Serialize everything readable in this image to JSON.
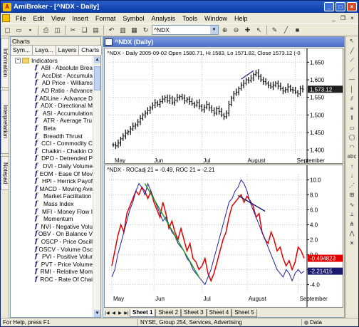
{
  "window": {
    "title": "AmiBroker - [^NDX - Daily]",
    "icon": "amibroker-icon"
  },
  "menu": [
    "File",
    "Edit",
    "View",
    "Insert",
    "Format",
    "Symbol",
    "Analysis",
    "Tools",
    "Window",
    "Help"
  ],
  "toolbar": {
    "symbol_value": "^NDX"
  },
  "side_tabs": [
    "Information",
    "Interpretation",
    "Notepad"
  ],
  "charts_panel": {
    "header": "Charts",
    "tabs": [
      "Sym...",
      "Layo...",
      "Layers",
      "Charts"
    ],
    "active_tab": "Charts",
    "folder": "Indicators",
    "items": [
      "ABI - Absolute Brea",
      "AccDist - Accumula",
      "AD Price - Williams",
      "AD Ratio - Advance",
      "ADLine - Advance D",
      "ADX - Directional M",
      "ASI - Accumulation",
      "ATR - Average Tru",
      "Beta",
      "Breadth Thrust",
      "CCI - Commodity C",
      "Chaikin - Chaikin O",
      "DPO - Detrended P",
      "DVI - Daily Volume",
      "EOM - Ease Of Mov",
      "HPI - Herrick Payof",
      "MACD - Moving Ave",
      "Market Facilitation",
      "Mass Index",
      "MFI - Money Flow I",
      "Momentum",
      "NVI - Negative Volu",
      "OBV - On Balance V",
      "OSCP - Price Oscill",
      "OSCV - Volume Osc",
      "PVI - Positive Volur",
      "PVT - Price Volume",
      "RMI - Relative Mom",
      "ROC - Rate Of Chai"
    ]
  },
  "chart_window": {
    "title": "^NDX (Daily)",
    "price_header": "^NDX - Daily 2005-09-02 Open 1580.71, Hi 1583, Lo 1571.82, Close 1573.12 (-0",
    "roc_header": "^NDX - ROCadj 21 = -0.49, ROC 21 = -2.21",
    "sheets": [
      "Sheet 1",
      "Sheet 2",
      "Sheet 3",
      "Sheet 4",
      "Sheet 5"
    ],
    "active_sheet": "Sheet 1"
  },
  "status": {
    "help": "For Help, press F1",
    "info": "NYSE, Group 254, Services, Advertising",
    "data": "Data"
  },
  "chart_data": [
    {
      "type": "bar",
      "title": "^NDX - Daily 2005-09-02 Open 1580.71, Hi 1583, Lo 1571.82, Close 1573.12 (-0",
      "categories": [
        "May",
        "Jun",
        "Jul",
        "August",
        "September"
      ],
      "yticks": [
        1400,
        1450,
        1500,
        1550,
        1600,
        1650
      ],
      "ylim": [
        1385,
        1665
      ],
      "last_value": "1,573.12",
      "closes": [
        1415,
        1412,
        1420,
        1432,
        1440,
        1448,
        1452,
        1460,
        1468,
        1472,
        1480,
        1490,
        1500,
        1505,
        1512,
        1520,
        1528,
        1535,
        1530,
        1538,
        1545,
        1550,
        1540,
        1548,
        1535,
        1542,
        1550,
        1552,
        1548,
        1540,
        1545,
        1538,
        1532,
        1528,
        1535,
        1525,
        1515,
        1522,
        1530,
        1520,
        1512,
        1505,
        1518,
        1510,
        1500,
        1495,
        1505,
        1530,
        1548,
        1560,
        1565,
        1575,
        1585,
        1590,
        1600,
        1598,
        1605,
        1615,
        1620,
        1610,
        1600,
        1595,
        1590,
        1585,
        1580,
        1585,
        1590,
        1582,
        1575,
        1568,
        1572,
        1580,
        1572,
        1570,
        1565,
        1560,
        1575,
        1573
      ],
      "grid": true
    },
    {
      "type": "line",
      "title": "^NDX - ROCadj 21 = -0.49, ROC 21 = -2.21",
      "categories": [
        "May",
        "Jun",
        "Jul",
        "August",
        "September"
      ],
      "yticks": [
        -4.0,
        -2.0,
        0.0,
        2.0,
        4.0,
        6.0,
        8.0,
        10.0
      ],
      "ylim": [
        -5.2,
        10.8
      ],
      "series": [
        {
          "name": "ROCadj 21",
          "last": "-0.494823",
          "color": "#e00000",
          "values": [
            -1.5,
            0.5,
            2.5,
            4.0,
            3.0,
            5.5,
            6.5,
            7.5,
            8.5,
            8.0,
            9.0,
            8.5,
            7.5,
            8.5,
            7.0,
            6.0,
            5.0,
            7.0,
            5.5,
            3.5,
            4.5,
            3.0,
            2.0,
            3.5,
            2.0,
            0.5,
            1.5,
            -0.5,
            -1.0,
            -2.0,
            -1.5,
            -0.5,
            -2.5,
            -3.5,
            -2.5,
            -1.0,
            0.5,
            2.0,
            3.0,
            5.0,
            6.5,
            7.0,
            7.5,
            8.0,
            7.0,
            7.8,
            7.2,
            6.5,
            5.0,
            5.5,
            3.0,
            2.0,
            1.5,
            3.0,
            2.0,
            0.5,
            1.0,
            -0.5,
            -1.5,
            -0.8,
            -2.0,
            -1.0,
            1.0,
            0.5,
            -0.49
          ]
        },
        {
          "name": "ROC 21",
          "last": "-2.21415",
          "color": "#2020a0",
          "values": [
            -3.0,
            -2.0,
            0.0,
            1.5,
            3.0,
            4.5,
            6.0,
            7.0,
            8.5,
            9.5,
            9.0,
            8.0,
            9.5,
            8.5,
            7.5,
            6.5,
            5.5,
            4.5,
            5.0,
            4.0,
            3.0,
            2.5,
            1.5,
            1.0,
            0.5,
            -0.5,
            -1.0,
            -2.0,
            -2.5,
            -3.0,
            -3.5,
            -4.0,
            -3.0,
            -2.0,
            -0.5,
            1.0,
            2.5,
            4.0,
            5.5,
            7.0,
            7.5,
            8.5,
            9.0,
            10.0,
            9.5,
            8.5,
            7.0,
            6.0,
            5.0,
            4.0,
            3.0,
            2.0,
            1.0,
            0.0,
            -1.0,
            -2.0,
            -2.5,
            -3.0,
            -2.0,
            -2.5,
            -3.5,
            -2.5,
            -2.0,
            -2.5,
            -2.21
          ]
        }
      ],
      "grid": true
    }
  ],
  "colors": {
    "price_bars": "#000000",
    "roc_adj": "#e00000",
    "roc": "#2020a0",
    "trend_green": "#1a9a1a",
    "trend_navy": "#1a1a6e",
    "last_value_bg": "#202020"
  }
}
